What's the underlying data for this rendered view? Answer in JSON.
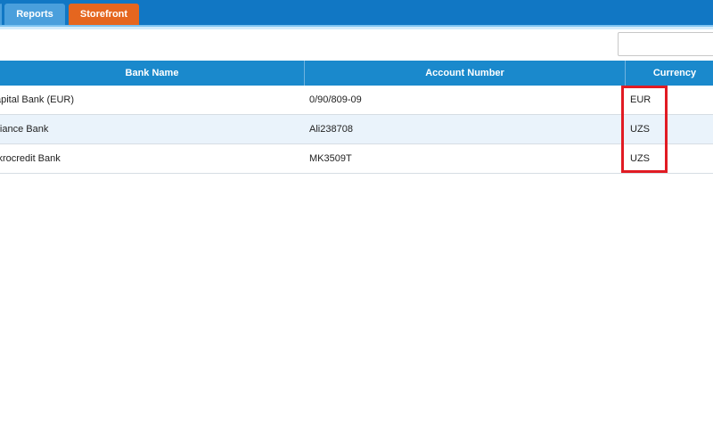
{
  "nav": {
    "tabs": [
      {
        "label": ""
      },
      {
        "label": "Reports"
      },
      {
        "label": "Storefront"
      }
    ]
  },
  "search": {
    "value": "",
    "placeholder": ""
  },
  "table": {
    "columns": [
      "Bank Name",
      "Account Number",
      "Currency"
    ],
    "rows": [
      {
        "bank": "apital Bank (EUR)",
        "account": "0/90/809-09",
        "currency": "EUR"
      },
      {
        "bank": "lliance Bank",
        "account": "Ali238708",
        "currency": "UZS"
      },
      {
        "bank": "ikrocredit Bank",
        "account": "MK3509T",
        "currency": "UZS"
      }
    ]
  },
  "colors": {
    "nav_bar": "#1177c4",
    "tab_blue": "#4a9fdc",
    "tab_active": "#e5661f",
    "header_bg": "#1a89cc",
    "row_alt": "#eaf3fb",
    "highlight": "#e11b23"
  }
}
